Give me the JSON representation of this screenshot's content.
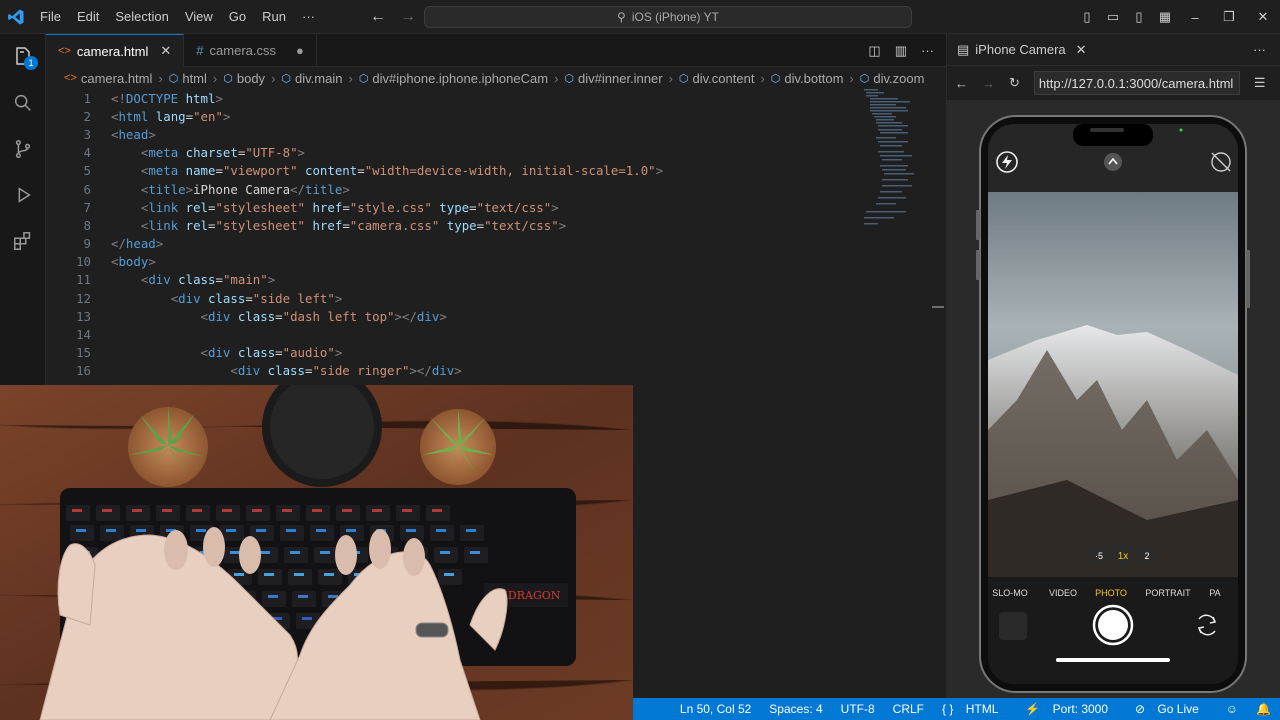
{
  "menu": [
    "File",
    "Edit",
    "Selection",
    "View",
    "Go",
    "Run",
    "···"
  ],
  "command_center": "iOS (iPhone) YT",
  "activity": {
    "badge": "1"
  },
  "tabs": [
    {
      "label": "camera.html",
      "icon": "<>",
      "close": "✕"
    },
    {
      "label": "camera.css",
      "icon": "#",
      "close": "●"
    }
  ],
  "breadcrumbs": [
    "camera.html",
    "html",
    "body",
    "div.main",
    "div#iphone.iphone.iphoneCam",
    "div#inner.inner",
    "div.content",
    "div.bottom",
    "div.zoom"
  ],
  "code_lines": [
    {
      "n": "1",
      "parts": [
        [
          "tg",
          "<!"
        ],
        [
          "tn",
          "DOCTYPE"
        ],
        [
          "an",
          " html"
        ],
        [
          "tg",
          ">"
        ]
      ]
    },
    {
      "n": "2",
      "parts": [
        [
          "tg",
          "<"
        ],
        [
          "tn",
          "html"
        ],
        [
          "an",
          " lang"
        ],
        [
          "tx",
          "="
        ],
        [
          "av",
          "\"en\""
        ],
        [
          "tg",
          ">"
        ]
      ]
    },
    {
      "n": "3",
      "parts": [
        [
          "tg",
          "<"
        ],
        [
          "tn",
          "head"
        ],
        [
          "tg",
          ">"
        ]
      ]
    },
    {
      "n": "4",
      "parts": [
        [
          "tx",
          "    "
        ],
        [
          "tg",
          "<"
        ],
        [
          "tn",
          "meta"
        ],
        [
          "an",
          " charset"
        ],
        [
          "tx",
          "="
        ],
        [
          "av",
          "\"UTF-8\""
        ],
        [
          "tg",
          ">"
        ]
      ]
    },
    {
      "n": "5",
      "parts": [
        [
          "tx",
          "    "
        ],
        [
          "tg",
          "<"
        ],
        [
          "tn",
          "meta"
        ],
        [
          "an",
          " name"
        ],
        [
          "tx",
          "="
        ],
        [
          "av",
          "\"viewport\""
        ],
        [
          "an",
          " content"
        ],
        [
          "tx",
          "="
        ],
        [
          "av",
          "\"width=device-width, initial-scale=1.0\""
        ],
        [
          "tg",
          ">"
        ]
      ]
    },
    {
      "n": "6",
      "parts": [
        [
          "tx",
          "    "
        ],
        [
          "tg",
          "<"
        ],
        [
          "tn",
          "title"
        ],
        [
          "tg",
          ">"
        ],
        [
          "tx",
          "iPhone Camera"
        ],
        [
          "tg",
          "</"
        ],
        [
          "tn",
          "title"
        ],
        [
          "tg",
          ">"
        ]
      ]
    },
    {
      "n": "7",
      "parts": [
        [
          "tx",
          "    "
        ],
        [
          "tg",
          "<"
        ],
        [
          "tn",
          "link"
        ],
        [
          "an",
          " rel"
        ],
        [
          "tx",
          "="
        ],
        [
          "av",
          "\"stylesheet\""
        ],
        [
          "an",
          " href"
        ],
        [
          "tx",
          "="
        ],
        [
          "av",
          "\"style.css\""
        ],
        [
          "an",
          " type"
        ],
        [
          "tx",
          "="
        ],
        [
          "av",
          "\"text/css\""
        ],
        [
          "tg",
          ">"
        ]
      ]
    },
    {
      "n": "8",
      "parts": [
        [
          "tx",
          "    "
        ],
        [
          "tg",
          "<"
        ],
        [
          "tn",
          "link"
        ],
        [
          "an",
          " rel"
        ],
        [
          "tx",
          "="
        ],
        [
          "av",
          "\"stylesheet\""
        ],
        [
          "an",
          " href"
        ],
        [
          "tx",
          "="
        ],
        [
          "av",
          "\"camera.css\""
        ],
        [
          "an",
          " type"
        ],
        [
          "tx",
          "="
        ],
        [
          "av",
          "\"text/css\""
        ],
        [
          "tg",
          ">"
        ]
      ]
    },
    {
      "n": "9",
      "parts": [
        [
          "tg",
          "</"
        ],
        [
          "tn",
          "head"
        ],
        [
          "tg",
          ">"
        ]
      ]
    },
    {
      "n": "10",
      "parts": [
        [
          "tg",
          "<"
        ],
        [
          "tn",
          "body"
        ],
        [
          "tg",
          ">"
        ]
      ]
    },
    {
      "n": "11",
      "parts": [
        [
          "tx",
          "    "
        ],
        [
          "tg",
          "<"
        ],
        [
          "tn",
          "div"
        ],
        [
          "an",
          " class"
        ],
        [
          "tx",
          "="
        ],
        [
          "av",
          "\"main\""
        ],
        [
          "tg",
          ">"
        ]
      ]
    },
    {
      "n": "12",
      "parts": [
        [
          "tx",
          "        "
        ],
        [
          "tg",
          "<"
        ],
        [
          "tn",
          "div"
        ],
        [
          "an",
          " class"
        ],
        [
          "tx",
          "="
        ],
        [
          "av",
          "\"side left\""
        ],
        [
          "tg",
          ">"
        ]
      ]
    },
    {
      "n": "13",
      "parts": [
        [
          "tx",
          "            "
        ],
        [
          "tg",
          "<"
        ],
        [
          "tn",
          "div"
        ],
        [
          "an",
          " class"
        ],
        [
          "tx",
          "="
        ],
        [
          "av",
          "\"dash left top\""
        ],
        [
          "tg",
          "></"
        ],
        [
          "tn",
          "div"
        ],
        [
          "tg",
          ">"
        ]
      ]
    },
    {
      "n": "14",
      "parts": []
    },
    {
      "n": "15",
      "parts": [
        [
          "tx",
          "            "
        ],
        [
          "tg",
          "<"
        ],
        [
          "tn",
          "div"
        ],
        [
          "an",
          " class"
        ],
        [
          "tx",
          "="
        ],
        [
          "av",
          "\"audio\""
        ],
        [
          "tg",
          ">"
        ]
      ]
    },
    {
      "n": "16",
      "parts": [
        [
          "tx",
          "                "
        ],
        [
          "tg",
          "<"
        ],
        [
          "tn",
          "div"
        ],
        [
          "an",
          " class"
        ],
        [
          "tx",
          "="
        ],
        [
          "av",
          "\"side ringer\""
        ],
        [
          "tg",
          "></"
        ],
        [
          "tn",
          "div"
        ],
        [
          "tg",
          ">"
        ]
      ]
    }
  ],
  "preview": {
    "tab_label": "iPhone Camera",
    "url": "http://127.0.0.1:3000/camera.html",
    "zoom": [
      "·5",
      "1x",
      "2"
    ],
    "modes": [
      "SLO-MO",
      "VIDEO",
      "PHOTO",
      "PORTRAIT",
      "PA"
    ],
    "active_mode": "PHOTO"
  },
  "keyboard_brand": "REDRAGON",
  "status": [
    "Ln 50, Col 52",
    "Spaces: 4",
    "UTF-8",
    "CRLF",
    "HTML",
    "Port: 3000",
    "Go Live"
  ],
  "colors": {
    "accent": "#0078d4",
    "photo_mode": "#f5c518"
  }
}
